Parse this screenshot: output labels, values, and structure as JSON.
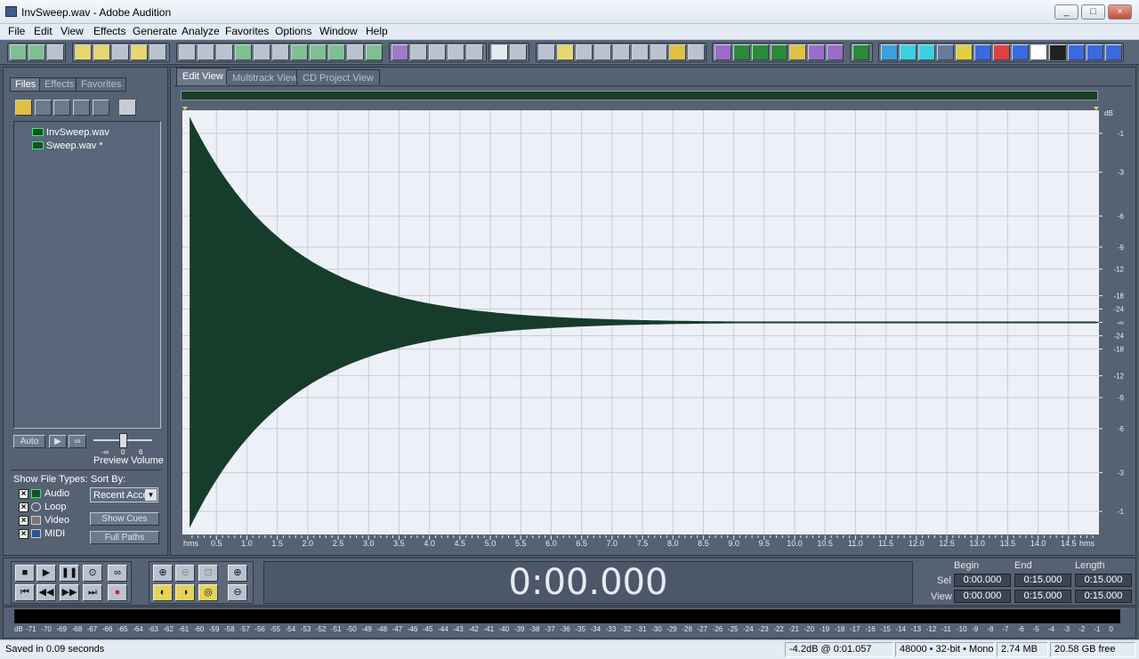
{
  "window": {
    "title": "InvSweep.wav - Adobe Audition",
    "min": "0",
    "max": "1",
    "close": "r"
  },
  "menu": [
    "File",
    "Edit",
    "View",
    "Effects",
    "Generate",
    "Analyze",
    "Favorites",
    "Options",
    "Window",
    "Help"
  ],
  "left_panel": {
    "tabs": [
      "Files",
      "Effects",
      "Favorites"
    ],
    "active_tab": "Files",
    "files": [
      "InvSweep.wav",
      "Sweep.wav *"
    ],
    "auto_label": "Auto",
    "preview_volume_label": "Preview Volume",
    "volume_min": "-∞",
    "volume_mid": "0",
    "volume_max": "6",
    "show_file_types_label": "Show File Types:",
    "file_types": [
      {
        "label": "Audio",
        "checked": true
      },
      {
        "label": "Loop",
        "checked": true
      },
      {
        "label": "Video",
        "checked": true
      },
      {
        "label": "MIDI",
        "checked": true
      }
    ],
    "sort_by_label": "Sort By:",
    "sort_by_value": "Recent Acce",
    "show_cues_button": "Show Cues",
    "full_paths_button": "Full Paths"
  },
  "view_tabs": [
    "Edit View",
    "Multitrack View",
    "CD Project View"
  ],
  "active_view": "Edit View",
  "waveform": {
    "color": "#163d2b",
    "background": "#eef0f8",
    "time_unit_label": "hms",
    "time_ticks": [
      "0.5",
      "1.0",
      "1.5",
      "2.0",
      "2.5",
      "3.0",
      "3.5",
      "4.0",
      "4.5",
      "5.0",
      "5.5",
      "6.0",
      "6.5",
      "7.0",
      "7.5",
      "8.0",
      "8.5",
      "9.0",
      "9.5",
      "10.0",
      "10.5",
      "11.0",
      "11.5",
      "12.0",
      "12.5",
      "13.0",
      "13.5",
      "14.0",
      "14.5"
    ],
    "db_unit_label": "dB",
    "db_ticks": [
      "-1",
      "-3",
      "-6",
      "-9",
      "-12",
      "-18",
      "-24",
      "-∞",
      "-24",
      "-18",
      "-12",
      "-9",
      "-6",
      "-3",
      "-1"
    ],
    "duration_s": 15.0,
    "envelope_peak": 0.97
  },
  "transport": {
    "time": "0:00.000",
    "buttons": [
      "stop",
      "play",
      "pause",
      "play-to-end",
      "loop",
      "go-to-start",
      "rewind",
      "fast-forward",
      "go-to-end",
      "record"
    ]
  },
  "selection": {
    "headers": [
      "Begin",
      "End",
      "Length"
    ],
    "sel_label": "Sel",
    "view_label": "View",
    "sel": [
      "0:00.000",
      "0:15.000",
      "0:15.000"
    ],
    "view": [
      "0:00.000",
      "0:15.000",
      "0:15.000"
    ]
  },
  "meter_scale": [
    "dB",
    "-71",
    "-70",
    "-69",
    "-68",
    "-67",
    "-66",
    "-65",
    "-64",
    "-63",
    "-62",
    "-61",
    "-60",
    "-59",
    "-58",
    "-57",
    "-56",
    "-55",
    "-54",
    "-53",
    "-52",
    "-51",
    "-50",
    "-49",
    "-48",
    "-47",
    "-46",
    "-45",
    "-44",
    "-43",
    "-42",
    "-41",
    "-40",
    "-39",
    "-38",
    "-37",
    "-36",
    "-35",
    "-34",
    "-33",
    "-32",
    "-31",
    "-30",
    "-29",
    "-28",
    "-27",
    "-26",
    "-25",
    "-24",
    "-23",
    "-22",
    "-21",
    "-20",
    "-19",
    "-18",
    "-17",
    "-16",
    "-15",
    "-14",
    "-13",
    "-12",
    "-11",
    "-10",
    "-9",
    "-8",
    "-7",
    "-6",
    "-5",
    "-4",
    "-3",
    "-2",
    "-1",
    "0"
  ],
  "status": {
    "message": "Saved in 0.09 seconds",
    "cursor": "-4.2dB @   0:01.057",
    "format": "48000 • 32-bit • Mono",
    "size": "2.74 MB",
    "free": "20.58 GB free"
  }
}
